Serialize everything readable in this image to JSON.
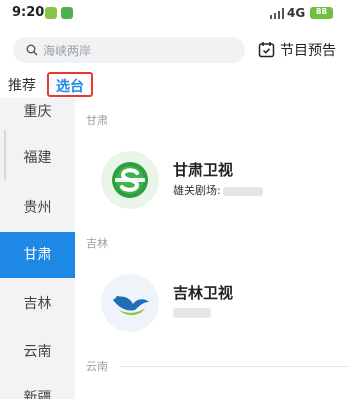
{
  "status_bar": {
    "time": "9:20",
    "network": "4G",
    "battery": "88"
  },
  "search": {
    "placeholder": "海峡两岸"
  },
  "header": {
    "preview_label": "节目预告"
  },
  "tabs": {
    "recommend": "推荐",
    "select_station": "选台"
  },
  "sidebar": {
    "items": [
      {
        "label": "重庆"
      },
      {
        "label": "福建"
      },
      {
        "label": "贵州"
      },
      {
        "label": "甘肃",
        "active": true
      },
      {
        "label": "吉林"
      },
      {
        "label": "云南"
      },
      {
        "label": "新疆"
      }
    ]
  },
  "sections": [
    {
      "title": "甘肃",
      "channel": {
        "name": "甘肃卫视",
        "subtitle": "雄关剧场:"
      }
    },
    {
      "title": "吉林",
      "channel": {
        "name": "吉林卫视",
        "subtitle": ""
      }
    },
    {
      "title": "云南"
    }
  ],
  "colors": {
    "accent": "#1e88e5",
    "highlight_border": "#e53935"
  }
}
